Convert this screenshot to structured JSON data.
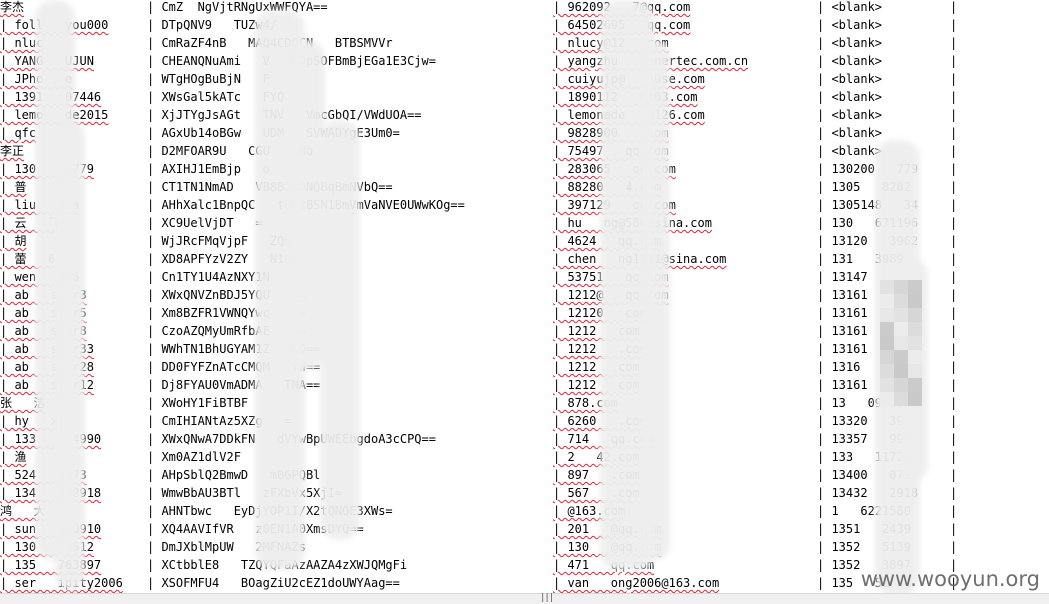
{
  "rows": [
    {
      "c0": "李杰",
      "c1": "| CmZ  NgVjtRNgUxWWFQYA==",
      "c2": "| 962092   7@qq.com",
      "c3": "| <blank>",
      "c4": "|"
    },
    {
      "c0": "| foll   you000",
      "c1": "| DTpQNV9   TUZw4/",
      "c2": "| 64502695   qq.com",
      "c3": "| <blank>",
      "c4": "|"
    },
    {
      "c0": "| nluc",
      "c1": "| CmRaZF4nB   MAQ4CDOCN   BTBSMVVr",
      "c2": "| nlucy@12   com",
      "c3": "| <blank>",
      "c4": "|"
    },
    {
      "c0": "| YANG   UJUN",
      "c1": "| CHEANQNuAmi   V   UDpSOFBmBjEGa1E3Cjw=",
      "c2": "| yangzhu   zenertec.com.cn",
      "c3": "| <blank>",
      "c4": "|"
    },
    {
      "c0": "| JPho   e",
      "c1": "| WTgHOgBuBjN   F",
      "c2": "| cuiyujp@   ouse.com",
      "c3": "| <blank>",
      "c4": "|"
    },
    {
      "c0": "| 1391   07446",
      "c1": "| XWsGal5kATc   FYQ",
      "c2": "| 1890112   @163.com",
      "c3": "| <blank>",
      "c4": "|"
    },
    {
      "c0": "| lemo   de2015",
      "c1": "| XjJTYgJsAGt   TNV   VmcGbQI/VWdUOA==",
      "c2": "| lemonade   @126.com",
      "c3": "| <blank>",
      "c4": "|"
    },
    {
      "c0": "| qfc",
      "c1": "| AGxUb14oBGw   UDM   SVWADYgE3Um0=",
      "c2": "| 9828900   .com",
      "c3": "| <blank>",
      "c4": "|"
    },
    {
      "c0": "李正",
      "c1": "| D2MFOAR9U   CGU   wNo",
      "c2": "| 75497   qq.com",
      "c3": "| <blank>",
      "c4": "|"
    },
    {
      "c0": "| 130   16779",
      "c1": "| AXIHJ1EmBjp   o",
      "c2": "| 283065   qq.com",
      "c3": "| 130200   779",
      "c4": "|"
    },
    {
      "c0": "| 普",
      "c1": "| CT1TN1NmAD   VB8B2sDNQBqBmNVbQ==",
      "c2": "| 88280   4.com",
      "c3": "| 1305   8202",
      "c4": "|"
    },
    {
      "c0": "| liu   xia",
      "c1": "| AHhXalc1BnpQC   tQV2BSN1BmVmVaNVE0UWwKOg==",
      "c2": "| 397129   qq.com",
      "c3": "| 1305148   34",
      "c4": "|"
    },
    {
      "c0": "| 云   飞步",
      "c1": "| XC9UelVjDT   =",
      "c2": "| hu   ng@5808sina.com",
      "c3": "| 130   671196",
      "c4": "|"
    },
    {
      "c0": "| 胡",
      "c1": "| WjJRcFMqVjpF   ZQNn",
      "c2": "| 4624   qq.com",
      "c3": "| 13120   3962",
      "c4": "|"
    },
    {
      "c0": "| 蕾   6",
      "c1": "| XD8APFYzV2ZY   N103",
      "c2": "| chen   ng1111@sina.com",
      "c3": "| 131   3989",
      "c4": "|"
    },
    {
      "c0": "| wen   666",
      "c1": "| Cn1TY1U4AzNXY1N   ",
      "c2": "| 53751   qq.com",
      "c3": "| 13147",
      "c4": "|"
    },
    {
      "c0": "| ab   star3",
      "c1": "| XWxQNVZnBDJ5YQU   ==",
      "c2": "| 1212@   qq.com",
      "c3": "| 13161",
      "c4": "|"
    },
    {
      "c0": "| ab   star5",
      "c1": "| Xm8BZFR1VWNQYwc   ==",
      "c2": "| 12120   com",
      "c3": "| 13161",
      "c4": "|"
    },
    {
      "c0": "| ab   star8",
      "c1": "| CzoAZQMyUmRfbAE   ==",
      "c2": "| 1212   com",
      "c3": "| 13161",
      "c4": "|"
    },
    {
      "c0": "| ab   star33",
      "c1": "| WWhTN1BhUGYAM1Z   NQ==",
      "c2": "| 1212   .com",
      "c3": "| 13161",
      "c4": "|"
    },
    {
      "c0": "| ab   star28",
      "c1": "| DD0FYFZnATcCMQM   YW==",
      "c2": "| 1212   com",
      "c3": "| 1316",
      "c4": "|"
    },
    {
      "c0": "| ab   star12",
      "c1": "| Dj8FYAU0VmADMA   TNA==",
      "c2": "| 1212   com",
      "c3": "| 13161",
      "c4": "|"
    },
    {
      "c0": "张   洁",
      "c1": "| XWoHY1FiBTBF   ",
      "c2": "| 878.com",
      "c3": "| 13   09775",
      "c4": "|"
    },
    {
      "c0": "| hy   x",
      "c1": "| CmIHIANtAz5XZg   =",
      "c2": "| 6260   .com",
      "c3": "| 13320   391",
      "c4": "|"
    },
    {
      "c0": "| 133   734990",
      "c1": "| XWxQNwA7DDkFN   dVYwBpUWEEbgdoA3cCPQ==",
      "c2": "| 714   qq.com",
      "c3": "| 13357   990",
      "c4": "|"
    },
    {
      "c0": "| 渔",
      "c1": "| Xm0AZ1dlV2F   ",
      "c2": "| 2   42.com",
      "c3": "| 133   11728",
      "c4": "|"
    },
    {
      "c0": "| 524   9473",
      "c1": "| AHpSblQ2BmwD   m0GPQBl",
      "c2": "| 897   .com",
      "c3": "| 13400   079",
      "c4": "|"
    },
    {
      "c0": "| 134   882918",
      "c1": "| WmwBbAU3BTl   zFXbVx5XjI=",
      "c2": "| 567   .com",
      "c3": "| 13432   2918",
      "c4": "|"
    },
    {
      "c0": "鸿   大",
      "c1": "| AHNTbwc   EyDjYOP1I/X2tQNQE3XWs=",
      "c2": "| @163.com",
      "c3": "| 1   6221580",
      "c4": "|"
    },
    {
      "c0": "| sun   980910",
      "c1": "| XQ4AAVIfVR   z0EN1A0XmsDYQ==",
      "c2": "| 201   @qq.com",
      "c3": "| 1351   2439",
      "c4": "|"
    },
    {
      "c0": "| 130   79512",
      "c1": "| DmJXblMpUW   2MFNAZs",
      "c2": "| 130   @qq.com",
      "c3": "| 1352   5139",
      "c4": "|"
    },
    {
      "c0": "| 135   763897",
      "c1": "| XCtbblE8   TZQYQFaAzAAZA4zXWJQMgFi",
      "c2": "| 471   qq.com",
      "c3": "| 1352   3897",
      "c4": "|"
    },
    {
      "c0": "| ser   ipity2006",
      "c1": "| XSOFMFU4   BOagZiU2cEZ1doUWYAag==",
      "c2": "| van   ong2006@163.com",
      "c3": "| 135   51",
      "c4": "|"
    }
  ],
  "scrollbar": {
    "grip": "|||"
  },
  "watermark": "www.wooyun.org",
  "colors": {
    "background": "#ffffff",
    "text": "#000000",
    "spell_underline": "#dd2222",
    "scrollbar": "#f0f0f0"
  }
}
